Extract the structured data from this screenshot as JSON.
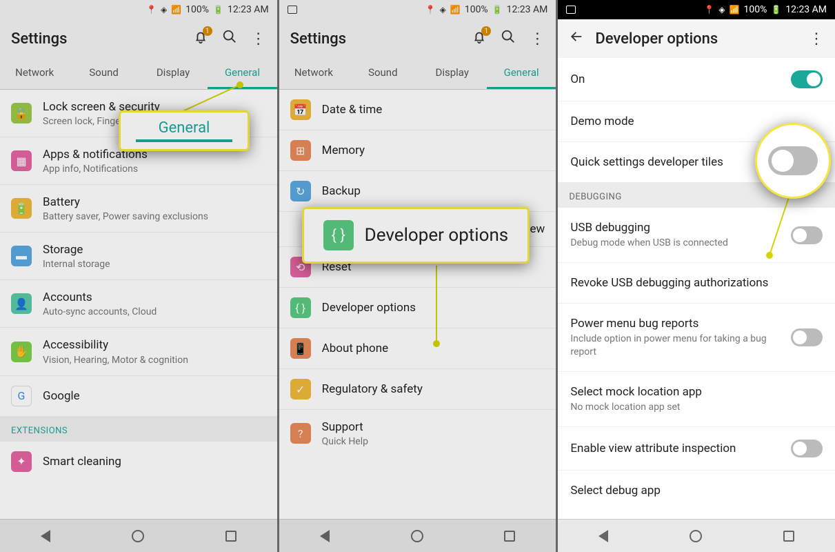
{
  "status": {
    "battery": "100%",
    "time": "12:23 AM"
  },
  "header": {
    "settings": "Settings",
    "devopt": "Developer options",
    "badge": "1"
  },
  "tabs": {
    "network": "Network",
    "sound": "Sound",
    "display": "Display",
    "general": "General"
  },
  "p1": {
    "lock": {
      "t": "Lock screen & security",
      "s": "Screen lock, Fingerprints"
    },
    "apps": {
      "t": "Apps & notifications",
      "s": "App info, Notifications"
    },
    "battery": {
      "t": "Battery",
      "s": "Battery saver, Power saving exclusions"
    },
    "storage": {
      "t": "Storage",
      "s": "Internal storage"
    },
    "accounts": {
      "t": "Accounts",
      "s": "Auto-sync accounts, Cloud"
    },
    "access": {
      "t": "Accessibility",
      "s": "Vision, Hearing, Motor & cognition"
    },
    "google": {
      "t": "Google"
    },
    "ext": "EXTENSIONS",
    "smart": {
      "t": "Smart cleaning"
    }
  },
  "p2": {
    "date": {
      "t": "Date & time"
    },
    "memory": {
      "t": "Memory"
    },
    "backup": {
      "t": "Backup"
    },
    "partial": {
      "t": "ew"
    },
    "reset": {
      "t": "Reset"
    },
    "dev": {
      "t": "Developer options"
    },
    "about": {
      "t": "About phone"
    },
    "reg": {
      "t": "Regulatory & safety"
    },
    "support": {
      "t": "Support",
      "s": "Quick Help"
    }
  },
  "p3": {
    "on": "On",
    "demo": "Demo mode",
    "quick": "Quick settings developer tiles",
    "debugging": "DEBUGGING",
    "usb": {
      "t": "USB debugging",
      "s": "Debug mode when USB is connected"
    },
    "revoke": "Revoke USB debugging authorizations",
    "power": {
      "t": "Power menu bug reports",
      "s": "Include option in power menu for taking a bug report"
    },
    "mock": {
      "t": "Select mock location app",
      "s": "No mock location app set"
    },
    "enable": "Enable view attribute inspection",
    "selapp": "Select debug app"
  },
  "callouts": {
    "general": "General",
    "dev": "Developer options"
  }
}
